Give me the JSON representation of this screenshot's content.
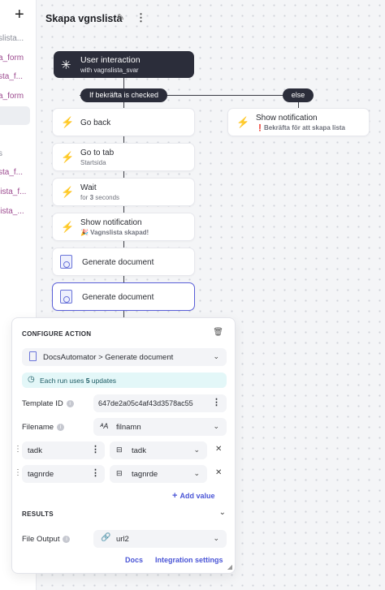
{
  "sidebar": {
    "add_icon": "plus-icon",
    "items": [
      {
        "label": "slista...",
        "color": "gray"
      },
      {
        "label": "a_form",
        "color": "purple"
      },
      {
        "label": "sta_f...",
        "color": "purple"
      },
      {
        "label": "a_form",
        "color": "purple"
      },
      {
        "label": "s",
        "color": "gray"
      },
      {
        "label": "sta_f...",
        "color": "purple"
      },
      {
        "label": "lista_f...",
        "color": "purple"
      },
      {
        "label": "lista_...",
        "color": "purple"
      }
    ]
  },
  "workflow": {
    "title": "Skapa vgnslista",
    "trigger": {
      "title": "User interaction",
      "subtitle": "with vagnslista_svar"
    },
    "branch_if": "If bekräfta is checked",
    "branch_else": "else",
    "nodes": [
      {
        "title": "Go back",
        "subtitle": "",
        "type": "action"
      },
      {
        "title": "Go to tab",
        "subtitle": "Startsida",
        "type": "action"
      },
      {
        "title": "Wait",
        "subtitle_prefix": "for ",
        "subtitle_bold": "3",
        "subtitle_suffix": " seconds",
        "type": "action"
      },
      {
        "title": "Show notification",
        "subtitle": "🎉 Vagnslista skapad!",
        "type": "action"
      },
      {
        "title": "Generate document",
        "subtitle": "",
        "type": "document"
      },
      {
        "title": "Generate document",
        "subtitle": "",
        "type": "document"
      }
    ],
    "else_node": {
      "title": "Show notification",
      "subtitle": "❗Bekräfta för att skapa lista"
    }
  },
  "configure": {
    "header": "CONFIGURE ACTION",
    "integration": "DocsAutomator > Generate document",
    "banner_prefix": "Each run uses ",
    "banner_bold": "5",
    "banner_suffix": " updates",
    "template_label": "Template ID",
    "template_value": "647de2a05c4af43d3578ac55",
    "filename_label": "Filename",
    "filename_value": "filnamn",
    "mappings": [
      {
        "key": "tadk",
        "value": "tadk"
      },
      {
        "key": "tagnrde",
        "value": "tagnrde"
      }
    ],
    "add_value": "Add value",
    "results_header": "RESULTS",
    "file_output_label": "File Output",
    "file_output_value": "url2",
    "docs_link": "Docs",
    "integration_settings_link": "Integration settings"
  },
  "colors": {
    "accent": "#4a55d6",
    "dark_node": "#2b2d3a",
    "banner_bg": "#e3f7f8"
  }
}
